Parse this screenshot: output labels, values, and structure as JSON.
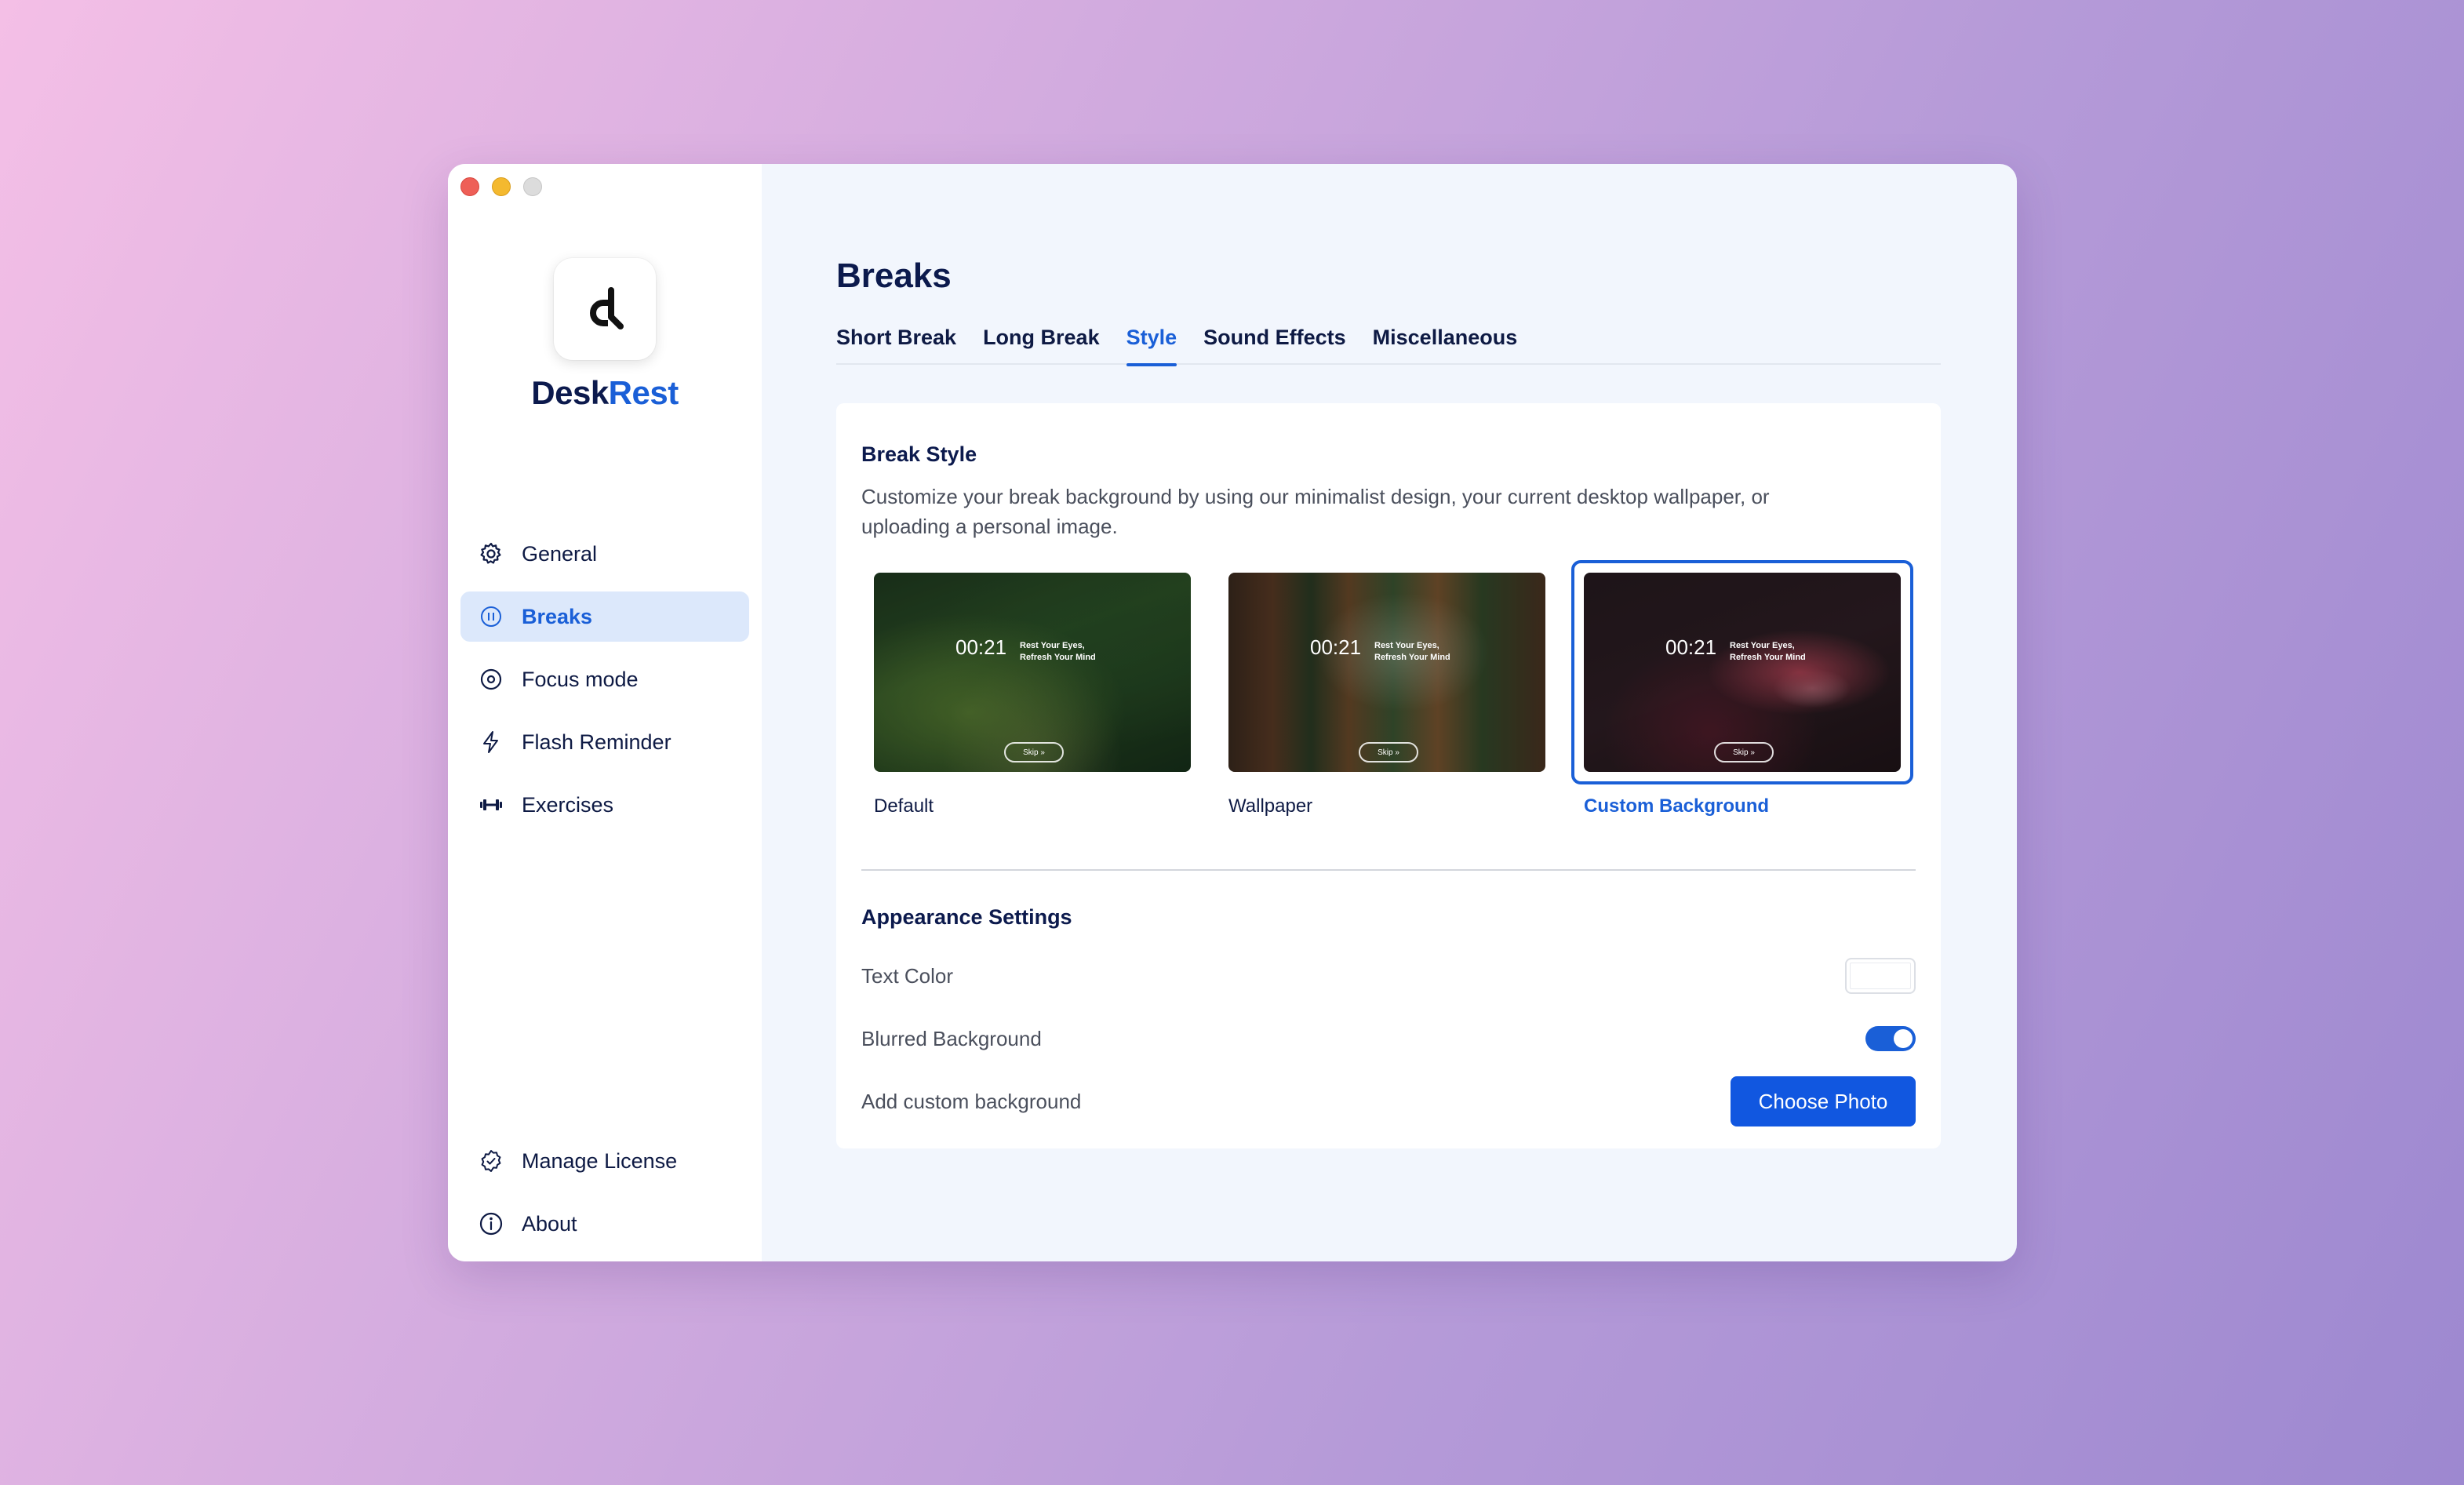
{
  "app": {
    "brand_part1": "Desk",
    "brand_part2": "Rest",
    "accent_color": "#1a5fd7"
  },
  "sidebar": {
    "items": [
      {
        "label": "General",
        "icon": "gear-icon"
      },
      {
        "label": "Breaks",
        "icon": "pause-circle-icon",
        "active": true
      },
      {
        "label": "Focus mode",
        "icon": "focus-target-icon"
      },
      {
        "label": "Flash Reminder",
        "icon": "lightning-icon"
      },
      {
        "label": "Exercises",
        "icon": "dumbbell-icon"
      }
    ],
    "bottom_items": [
      {
        "label": "Manage License",
        "icon": "badge-check-icon"
      },
      {
        "label": "About",
        "icon": "info-icon"
      }
    ]
  },
  "main": {
    "title": "Breaks",
    "tabs": [
      {
        "label": "Short Break"
      },
      {
        "label": "Long Break"
      },
      {
        "label": "Style",
        "active": true
      },
      {
        "label": "Sound Effects"
      },
      {
        "label": "Miscellaneous"
      }
    ]
  },
  "break_style": {
    "title": "Break Style",
    "description": "Customize your break background by using our minimalist design, your current desktop wallpaper, or uploading a personal image.",
    "options": [
      {
        "caption": "Default",
        "timer": "00:21",
        "message_line1": "Rest Your Eyes,",
        "message_line2": "Refresh Your Mind",
        "skip": "Skip »"
      },
      {
        "caption": "Wallpaper",
        "timer": "00:21",
        "message_line1": "Rest Your Eyes,",
        "message_line2": "Refresh Your Mind",
        "skip": "Skip »"
      },
      {
        "caption": "Custom Background",
        "timer": "00:21",
        "message_line1": "Rest Your Eyes,",
        "message_line2": "Refresh Your Mind",
        "skip": "Skip »",
        "selected": true
      }
    ]
  },
  "appearance": {
    "title": "Appearance Settings",
    "text_color_label": "Text Color",
    "text_color_value": "#ffffff",
    "blurred_label": "Blurred Background",
    "blurred_on": true,
    "custom_bg_label": "Add custom background",
    "choose_photo": "Choose Photo"
  }
}
